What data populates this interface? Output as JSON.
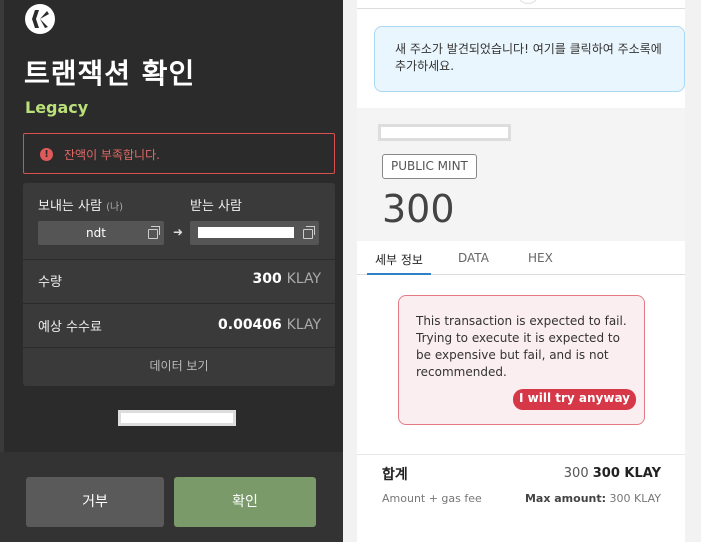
{
  "left": {
    "title": "트랜잭션 확인",
    "subtitle": "Legacy",
    "alert": {
      "icon": "!",
      "text": "잔액이 부족합니다."
    },
    "from_label": "보내는 사람",
    "from_hint": "(나)",
    "to_label": "받는 사람",
    "from_name": "ndt",
    "amount_label": "수량",
    "amount_value": "300",
    "amount_unit": "KLAY",
    "fee_label": "예상 수수료",
    "fee_value": "0.00406",
    "fee_unit": "KLAY",
    "view_data": "데이터 보기",
    "reject_button": "거부",
    "confirm_button": "확인"
  },
  "right": {
    "notice": "새 주소가 발견되었습니다! 여기를 클릭하여 주소록에 추가하세요.",
    "method": "PUBLIC MINT",
    "value": "300",
    "tabs": [
      "세부 정보",
      "DATA",
      "HEX"
    ],
    "fail_message": "This transaction is expected to fail. Trying to execute it is expected to be expensive but fail, and is not recommended.",
    "try_anyway": "I will try anyway",
    "total_label": "합계",
    "total_prefix": "300",
    "total_value": "300 KLAY",
    "total_sub": "Amount + gas fee",
    "max_label": "Max amount:",
    "max_value": "300 KLAY"
  },
  "colors": {
    "accent_green": "#b9e07a",
    "error_red": "#d6514f",
    "confirm_green": "#7a9a6a",
    "tab_blue": "#2f80c8",
    "danger_button": "#d73848"
  }
}
